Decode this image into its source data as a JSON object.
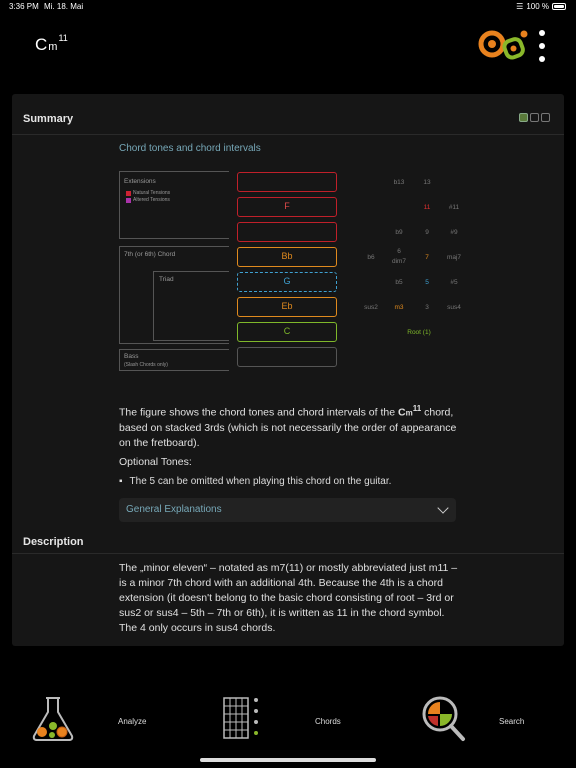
{
  "status_bar": {
    "time": "3:36 PM",
    "date": "Mi. 18. Mai",
    "battery": "100 %"
  },
  "header": {
    "chord_root": "C",
    "chord_quality": "m",
    "chord_extension": "11"
  },
  "summary": {
    "title": "Summary",
    "subheading": "Chord tones and chord intervals",
    "figure": {
      "labels": {
        "extensions": "Extensions",
        "natural_tensions": "Natural Tensions",
        "altered_tensions": "Altered Tensions",
        "seventh_chord": "7th (or 6th) Chord",
        "triad": "Triad",
        "bass": "Bass",
        "bass_note": "(Slash Chords only)"
      },
      "legend_colors": {
        "natural": "#cc2233",
        "altered": "#aa33aa"
      },
      "tones": [
        {
          "label": "",
          "color": "#c0202a"
        },
        {
          "label": "F",
          "color": "#c0202a"
        },
        {
          "label": "",
          "color": "#c0202a"
        },
        {
          "label": "Bb",
          "color": "#e08a1e"
        },
        {
          "label": "G",
          "color": "#3fa0d0"
        },
        {
          "label": "Eb",
          "color": "#e08a1e"
        },
        {
          "label": "C",
          "color": "#7fb82a"
        },
        {
          "label": "",
          "color": "#555555"
        }
      ],
      "intervals": {
        "row0": [
          "b13",
          "13"
        ],
        "row1": [
          "11",
          "#11"
        ],
        "row2": [
          "b9",
          "9",
          "#9"
        ],
        "row3": [
          "b6",
          "6",
          "dim7",
          "7",
          "maj7"
        ],
        "row4": [
          "b5",
          "5",
          "#5"
        ],
        "row5": [
          "sus2",
          "m3",
          "3",
          "sus4"
        ],
        "row6": [
          "Root (1)"
        ]
      }
    },
    "paragraph_pre": "The figure shows the chord tones and chord intervals of the ",
    "paragraph_chord_root": "C",
    "paragraph_chord_quality": "m",
    "paragraph_chord_ext": "11",
    "paragraph_post": " chord, based on stacked 3rds (which is not necessarily the order of appearance on the fretboard).",
    "optional_title": "Optional Tones:",
    "optional_bullet": "The 5 can be omitted when playing this chord on the guitar.",
    "general_explanations": "General Explanations"
  },
  "description": {
    "title": "Description",
    "text": "The „minor eleven“ – notated as m7(11) or mostly abbreviated just m11 – is a minor 7th chord with an additional 4th. Because the 4th is a chord extension (it doesn't belong to the basic chord consisting of root – 3rd or sus2 or sus4 – 5th – 7th or 6th), it is written as 11 in the chord symbol. The 4 only occurs in sus4 chords."
  },
  "tabbar": {
    "analyze": "Analyze",
    "chords": "Chords",
    "search": "Search"
  }
}
